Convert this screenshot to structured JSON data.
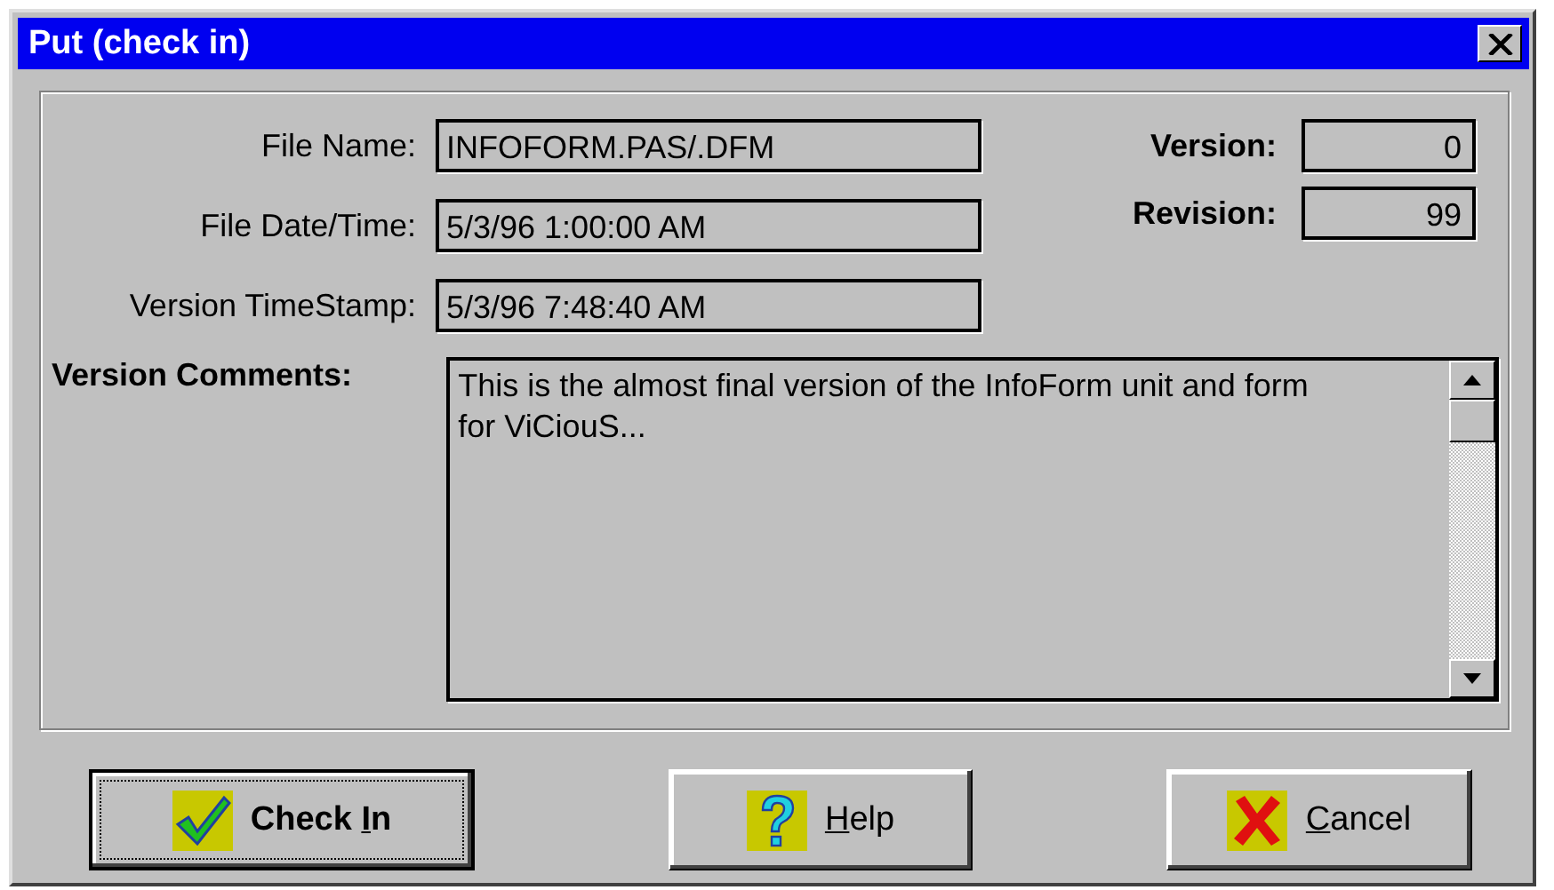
{
  "window": {
    "title": "Put (check in)"
  },
  "fields": [
    {
      "label": "File Name:",
      "value": "INFOFORM.PAS/.DFM"
    },
    {
      "label": "File Date/Time:",
      "value": "5/3/96 1:00:00 AM"
    },
    {
      "label": "Version TimeStamp:",
      "value": "5/3/96 7:48:40 AM"
    }
  ],
  "version_fields": [
    {
      "label": "Version:",
      "value": "0"
    },
    {
      "label": "Revision:",
      "value": "99"
    }
  ],
  "comments": {
    "label": "Version Comments:",
    "value": "This is the almost final version of the InfoForm unit and form for ViCiouS..."
  },
  "buttons": [
    {
      "kind": "check",
      "label": {
        "before": "Check ",
        "key": "I",
        "after": "n"
      },
      "default": true
    },
    {
      "kind": "help",
      "label": {
        "key": "H",
        "after": "elp"
      },
      "default": false
    },
    {
      "kind": "cancel",
      "label": {
        "key": "C",
        "after": "ancel"
      },
      "default": false
    }
  ]
}
